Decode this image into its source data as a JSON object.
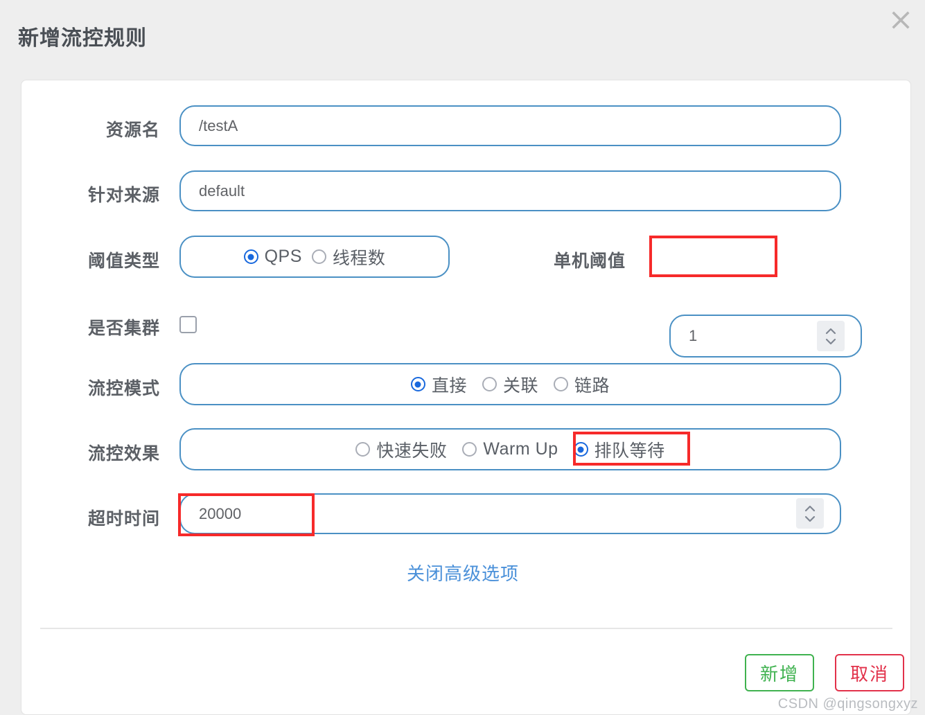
{
  "dialog": {
    "title": "新增流控规则",
    "close_icon": "close-icon"
  },
  "form": {
    "resource": {
      "label": "资源名",
      "value": "/testA",
      "placeholder": "资源名"
    },
    "limit_app": {
      "label": "针对来源",
      "value": "default",
      "placeholder": "default"
    },
    "threshold_type": {
      "label": "阈值类型",
      "options": [
        {
          "label": "QPS",
          "checked": true
        },
        {
          "label": "线程数",
          "checked": false
        }
      ]
    },
    "single_threshold": {
      "label": "单机阈值",
      "value": "1",
      "spinner_up_icon": "chevron-up-icon",
      "spinner_down_icon": "chevron-down-icon"
    },
    "cluster": {
      "label": "是否集群",
      "checked": false
    },
    "flow_mode": {
      "label": "流控模式",
      "options": [
        {
          "label": "直接",
          "checked": true
        },
        {
          "label": "关联",
          "checked": false
        },
        {
          "label": "链路",
          "checked": false
        }
      ]
    },
    "flow_effect": {
      "label": "流控效果",
      "options": [
        {
          "label": "快速失败",
          "checked": false
        },
        {
          "label": "Warm Up",
          "checked": false
        },
        {
          "label": "排队等待",
          "checked": true
        }
      ]
    },
    "timeout": {
      "label": "超时时间",
      "value": "20000",
      "spinner_up_icon": "chevron-up-icon",
      "spinner_down_icon": "chevron-down-icon"
    },
    "advanced_link": "关闭高级选项"
  },
  "footer": {
    "confirm_label": "新增",
    "cancel_label": "取消"
  },
  "watermark": "CSDN @qingsongxyz",
  "colors": {
    "page_bg": "#eeeeee",
    "card_bg": "#ffffff",
    "input_border": "#4a90c4",
    "radio_checked": "#1868dd",
    "link": "#4a90d9",
    "confirm": "#3fb24f",
    "cancel": "#e2314a",
    "annotation": "#f62a2a",
    "label_text": "#5c6066"
  }
}
